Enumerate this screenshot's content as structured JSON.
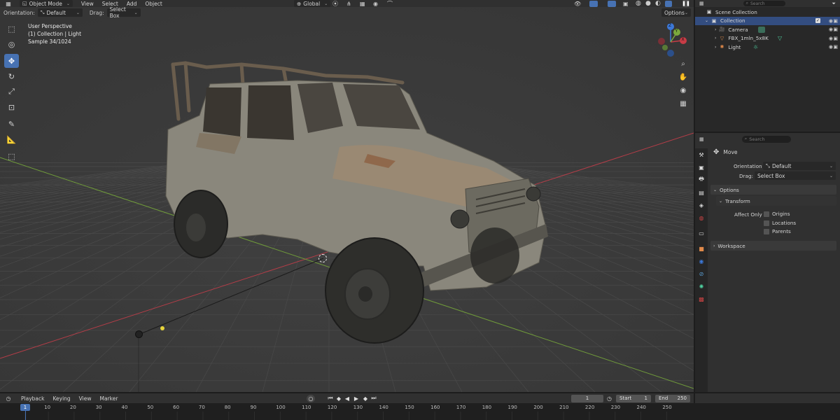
{
  "viewport_header": {
    "mode": "Object Mode",
    "menus": [
      "View",
      "Select",
      "Add",
      "Object"
    ],
    "transform_space": "Global"
  },
  "tool_settings": {
    "orientation_label": "Orientation:",
    "orientation_value": "Default",
    "drag_label": "Drag:",
    "drag_value": "Select Box",
    "options_label": "Options"
  },
  "overlay_text": {
    "line1": "User Perspective",
    "line2": "(1) Collection | Light",
    "line3": "Sample 34/1024"
  },
  "gizmo": {
    "z": "Z",
    "x": "X",
    "y": "Y"
  },
  "outliner": {
    "search_placeholder": "Search",
    "root": "Scene Collection",
    "collection": "Collection",
    "items": [
      {
        "name": "Camera",
        "icon": "camera-icon"
      },
      {
        "name": "FBX_1mln_5x8K",
        "icon": "mesh-icon"
      },
      {
        "name": "Light",
        "icon": "light-icon"
      }
    ]
  },
  "properties": {
    "search_placeholder": "Search",
    "tool_name": "Move",
    "orientation_label": "Orientation",
    "orientation_value": "Default",
    "drag_label": "Drag:",
    "drag_value": "Select Box",
    "options_panel": "Options",
    "transform_panel": "Transform",
    "affect_only_label": "Affect Only",
    "affect_only_items": [
      "Origins",
      "Locations",
      "Parents"
    ],
    "workspace_panel": "Workspace"
  },
  "timeline": {
    "menus": [
      "Playback",
      "Keying",
      "View",
      "Marker"
    ],
    "current_frame": "1",
    "start_label": "Start",
    "start_value": "1",
    "end_label": "End",
    "end_value": "250",
    "ticks": [
      "1",
      "10",
      "20",
      "30",
      "40",
      "50",
      "60",
      "70",
      "80",
      "90",
      "100",
      "110",
      "120",
      "130",
      "140",
      "150",
      "160",
      "170",
      "180",
      "190",
      "200",
      "210",
      "220",
      "230",
      "240",
      "250"
    ],
    "playhead": "1"
  },
  "colors": {
    "accent": "#4772b3",
    "x_axis": "#c83c46",
    "y_axis": "#7aa83c",
    "z_axis": "#3c78d8"
  }
}
